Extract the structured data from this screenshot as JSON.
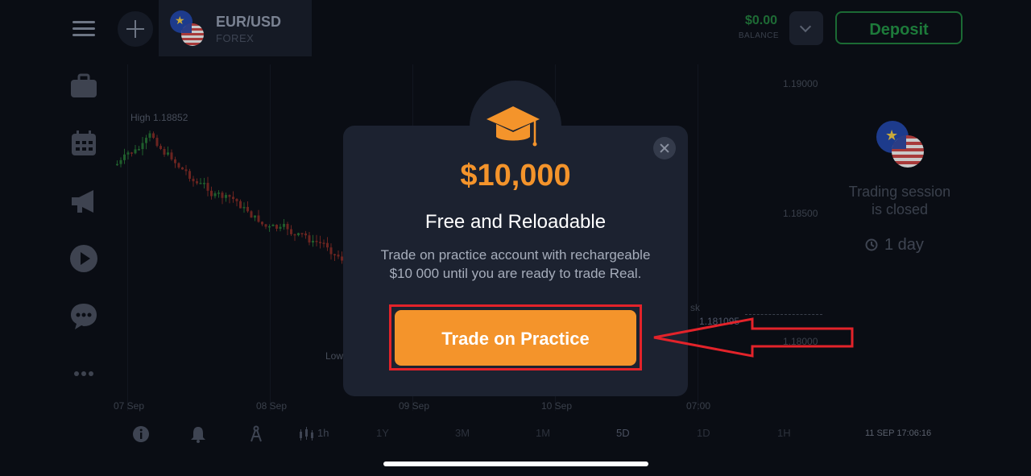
{
  "header": {
    "asset_name": "EUR/USD",
    "asset_type": "FOREX",
    "balance_value": "$0.00",
    "balance_label": "BALANCE",
    "deposit_label": "Deposit"
  },
  "sidebar": {
    "icons": [
      "briefcase-icon",
      "calendar-icon",
      "megaphone-icon",
      "play-icon",
      "chat-icon",
      "more-icon"
    ]
  },
  "chart": {
    "high_label": "High 1.18852",
    "low_label": "Low",
    "price_levels": [
      "1.19000",
      "1.18500",
      "1.18000"
    ],
    "current_price": "1.181095",
    "ask_label": "sk",
    "dates": [
      "07 Sep",
      "08 Sep",
      "09 Sep",
      "10 Sep",
      "07:00"
    ]
  },
  "session": {
    "text_line1": "Trading session",
    "text_line2": "is closed",
    "duration": "1 day"
  },
  "toolbar": {
    "candle_interval": "1h",
    "periods": [
      "1Y",
      "3M",
      "1M",
      "5D",
      "1D",
      "1H"
    ],
    "timestamp": "11 SEP 17:06:16"
  },
  "modal": {
    "amount": "$10,000",
    "title": "Free and Reloadable",
    "description_line1": "Trade on practice account with rechargeable",
    "description_line2": "$10 000 until you are ready to trade Real.",
    "button_label": "Trade on Practice"
  },
  "colors": {
    "accent_orange": "#f4942b",
    "deposit_green": "#1d7a3a",
    "annotation_red": "#e3232a",
    "modal_bg": "#1c2230"
  }
}
